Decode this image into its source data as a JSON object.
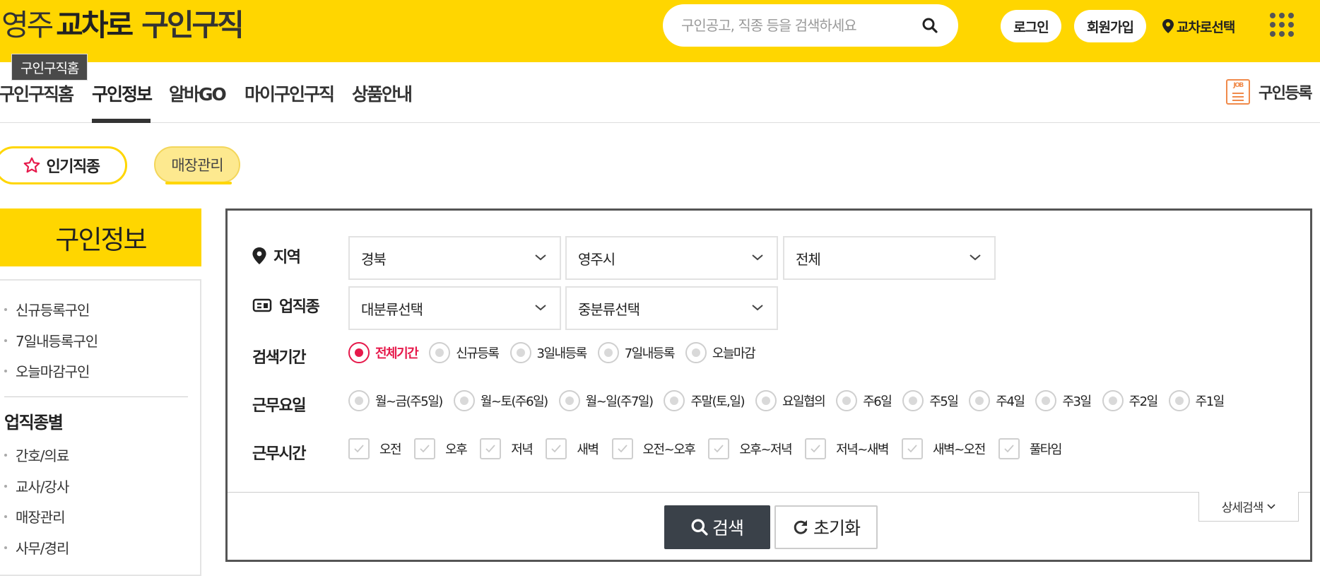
{
  "header": {
    "logo": {
      "part1": "영주",
      "part2": "교차로",
      "part3": "구인구직"
    },
    "search_placeholder": "구인공고, 직종 등을 검색하세요",
    "login_label": "로그인",
    "signup_label": "회원가입",
    "region_select_label": "교차로선택"
  },
  "tooltip": "구인구직홈",
  "nav": {
    "items": [
      "구인구직홈",
      "구인정보",
      "알바GO",
      "마이구인구직",
      "상품안내"
    ],
    "active": "구인정보",
    "job_register_label": "구인등록",
    "job_icon_text": "JOB"
  },
  "chips": {
    "popular_label": "인기직종",
    "store_label": "매장관리"
  },
  "sidebar": {
    "title": "구인정보",
    "quick_links": [
      "신규등록구인",
      "7일내등록구인",
      "오늘마감구인"
    ],
    "category_heading": "업직종별",
    "categories": [
      "간호/의료",
      "교사/강사",
      "매장관리",
      "사무/경리"
    ]
  },
  "search": {
    "region": {
      "label": "지역",
      "province": "경북",
      "city": "영주시",
      "district": "전체"
    },
    "job_type": {
      "label": "업직종",
      "major": "대분류선택",
      "minor": "중분류선택"
    },
    "period": {
      "label": "검색기간",
      "options": [
        "전체기간",
        "신규등록",
        "3일내등록",
        "7일내등록",
        "오늘마감"
      ],
      "selected": "전체기간"
    },
    "work_days": {
      "label": "근무요일",
      "options": [
        "월~금(주5일)",
        "월~토(주6일)",
        "월~일(주7일)",
        "주말(토,일)",
        "요일협의",
        "주6일",
        "주5일",
        "주4일",
        "주3일",
        "주2일",
        "주1일"
      ]
    },
    "work_hours": {
      "label": "근무시간",
      "options": [
        "오전",
        "오후",
        "저녁",
        "새벽",
        "오전~오후",
        "오후~저녁",
        "저녁~새벽",
        "새벽~오전",
        "풀타임"
      ]
    },
    "search_button": "검색",
    "reset_button": "초기화",
    "detail_button": "상세검색"
  },
  "colors": {
    "brand_yellow": "#ffd600",
    "selected_red": "#e6194b",
    "search_button_bg": "#3a4149"
  }
}
